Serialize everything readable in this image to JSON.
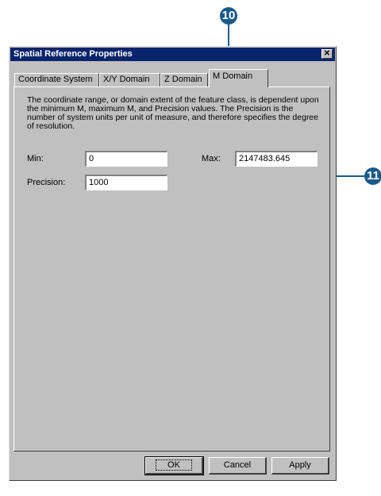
{
  "callouts": {
    "first": "10",
    "second": "11"
  },
  "dialog": {
    "title": "Spatial Reference Properties",
    "close_glyph": "✕",
    "tabs": [
      {
        "label": "Coordinate System"
      },
      {
        "label": "X/Y Domain"
      },
      {
        "label": "Z Domain"
      },
      {
        "label": "M Domain",
        "active": true
      }
    ],
    "description": "The coordinate range, or domain extent of the feature class, is dependent upon the minimum M, maximum M, and Precision values. The Precision is the number of system units per unit of measure, and therefore specifies the degree of resolution.",
    "fields": {
      "min_label": "Min:",
      "min_value": "0",
      "max_label": "Max:",
      "max_value": "2147483.645",
      "precision_label": "Precision:",
      "precision_value": "1000"
    },
    "buttons": {
      "ok": "OK",
      "cancel": "Cancel",
      "apply": "Apply"
    }
  },
  "colors": {
    "callout": "#1a5a8a",
    "titlebar": "#08246b",
    "dialog_bg": "#c0c0c0"
  }
}
